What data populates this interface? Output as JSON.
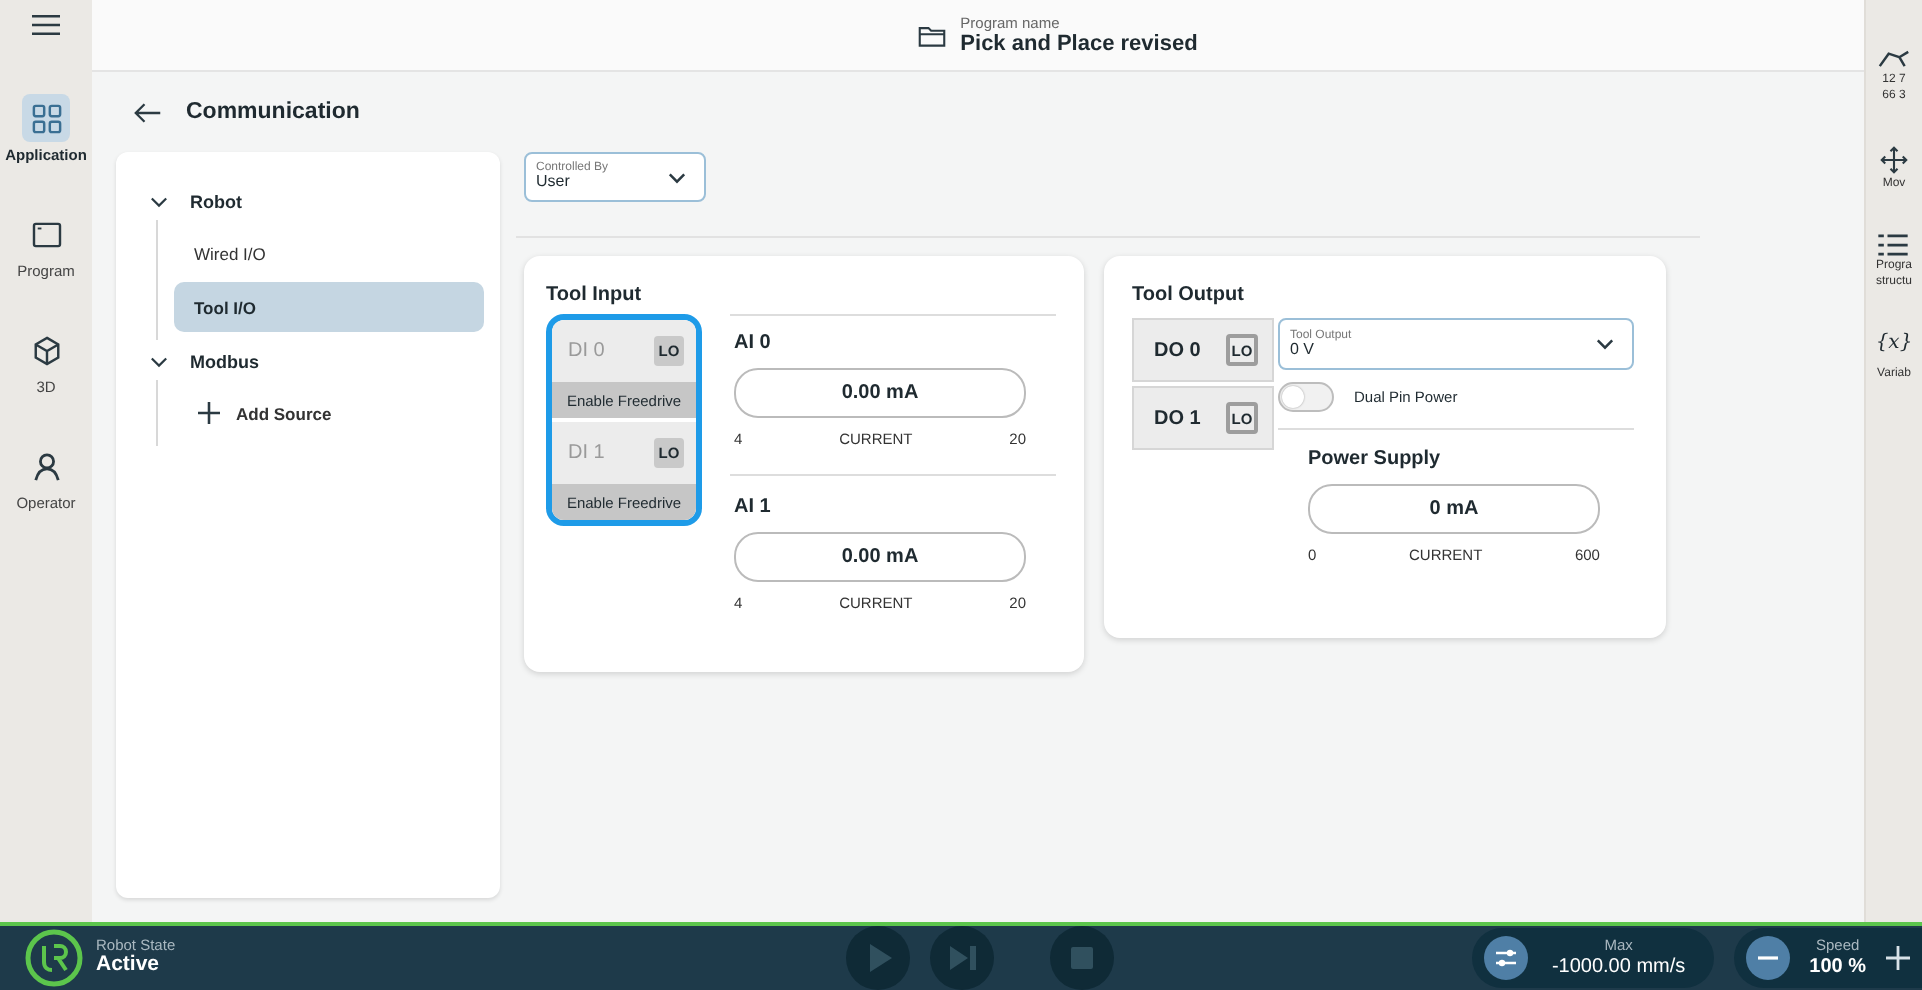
{
  "header": {
    "program_label": "Program name",
    "program_name": "Pick and Place revised"
  },
  "left_rail": {
    "items": [
      {
        "kind": "application",
        "label": "Application",
        "selected": true
      },
      {
        "kind": "program",
        "label": "Program",
        "selected": false
      },
      {
        "kind": "cube",
        "label": "3D",
        "selected": false
      },
      {
        "kind": "operator",
        "label": "Operator",
        "selected": false
      }
    ]
  },
  "right_rail": {
    "items": [
      {
        "kind": "robot",
        "lines": [
          "12 7",
          "66 3"
        ]
      },
      {
        "kind": "move",
        "lines": [
          "Mov"
        ]
      },
      {
        "kind": "structure",
        "lines": [
          "Progra",
          "structu"
        ]
      },
      {
        "kind": "variables",
        "glyph": "{x}",
        "lines": [
          "Variab"
        ]
      }
    ]
  },
  "page": {
    "title": "Communication"
  },
  "tree": [
    {
      "label": "Robot",
      "expanded": true,
      "children": [
        {
          "kind": "item",
          "label": "Wired I/O",
          "selected": false
        },
        {
          "kind": "item",
          "label": "Tool I/O",
          "selected": true
        }
      ]
    },
    {
      "label": "Modbus",
      "expanded": true,
      "children": [
        {
          "kind": "add",
          "label": "Add Source",
          "selected": false
        }
      ]
    }
  ],
  "controlled_by": {
    "label": "Controlled By",
    "value": "User"
  },
  "tool_input": {
    "title": "Tool Input",
    "focused": true,
    "digital": [
      {
        "name": "DI 0",
        "state": "LO",
        "function": "Enable Freedrive",
        "disabled": true
      },
      {
        "name": "DI 1",
        "state": "LO",
        "function": "Enable Freedrive",
        "disabled": true
      }
    ],
    "analog": [
      {
        "name": "AI 0",
        "value": "0.00 mA",
        "min": "4",
        "unit": "CURRENT",
        "max": "20"
      },
      {
        "name": "AI 1",
        "value": "0.00 mA",
        "min": "4",
        "unit": "CURRENT",
        "max": "20"
      }
    ]
  },
  "tool_output": {
    "title": "Tool Output",
    "digital": [
      {
        "name": "DO 0",
        "state": "LO"
      },
      {
        "name": "DO 1",
        "state": "LO"
      }
    ],
    "voltage": {
      "label": "Tool Output",
      "value": "0 V"
    },
    "dual_pin": {
      "label": "Dual Pin Power",
      "on": false
    },
    "power_supply": {
      "title": "Power Supply",
      "value": "0 mA",
      "min": "0",
      "unit": "CURRENT",
      "max": "600"
    }
  },
  "bottom_bar": {
    "robot_state_label": "Robot State",
    "robot_state": "Active",
    "max_label": "Max",
    "max_value": "-1000.00 mm/s",
    "speed_label": "Speed",
    "speed_value": "100 %"
  }
}
